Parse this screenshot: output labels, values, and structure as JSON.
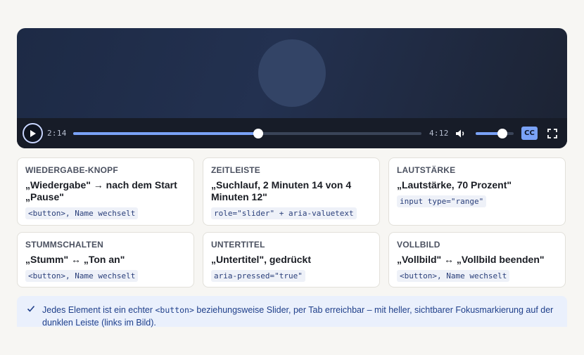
{
  "player": {
    "time_current": "2:14",
    "time_total": "4:12",
    "progress_fraction": 0.532,
    "volume_fraction": 0.7,
    "cc_label": "CC",
    "accent_color": "#7aa2f7",
    "icons": [
      "play-icon",
      "volume-icon",
      "fullscreen-icon"
    ]
  },
  "cards": [
    {
      "title": "Wiedergabe-Knopf",
      "desc": "„Wiedergabe\" → nach dem Start „Pause\"",
      "code": "<button>, Name wechselt"
    },
    {
      "title": "Zeitleiste",
      "desc": "„Suchlauf, 2 Minuten 14 von 4 Minuten 12\"",
      "code": "role=\"slider\" + aria-valuetext"
    },
    {
      "title": "Lautstärke",
      "desc": "„Lautstärke, 70 Prozent\"",
      "code": "input type=\"range\""
    },
    {
      "title": "Stummschalten",
      "desc": "„Stumm\" ↔ „Ton an\"",
      "code": "<button>, Name wechselt"
    },
    {
      "title": "Untertitel",
      "desc": "„Untertitel\", gedrückt",
      "code": "aria-pressed=\"true\""
    },
    {
      "title": "Vollbild",
      "desc": "„Vollbild\" ↔ „Vollbild beenden\"",
      "code": "<button>, Name wechselt"
    }
  ],
  "note": {
    "before": "Jedes Element ist ein echter ",
    "code": "<button>",
    "after": " beziehungsweise Slider, per Tab erreichbar – mit heller, sichtbarer Fokusmarkierung auf der dunklen Leiste (links im Bild)."
  }
}
